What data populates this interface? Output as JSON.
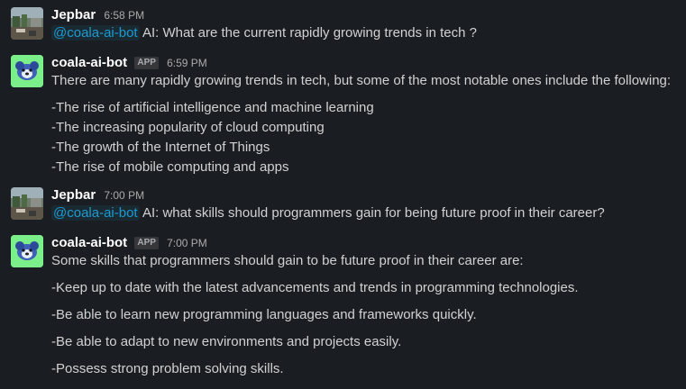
{
  "messages": [
    {
      "author": "Jepbar",
      "time": "6:58 PM",
      "avatar_icon": "photo-avatar",
      "mention": "@coala-ai-bot",
      "text": "AI: What are the current rapidly growing trends in tech ?"
    },
    {
      "author": "coala-ai-bot",
      "badge": "APP",
      "time": "6:59 PM",
      "avatar_icon": "bot-avatar",
      "intro": "There are many rapidly growing trends in tech, but some of the most notable ones include the following:",
      "items": [
        "-The rise of artificial intelligence and machine learning",
        "-The increasing popularity of cloud computing",
        "-The growth of the Internet of Things",
        "-The rise of mobile computing and apps"
      ]
    },
    {
      "author": "Jepbar",
      "time": "7:00 PM",
      "avatar_icon": "photo-avatar",
      "mention": "@coala-ai-bot",
      "text": "AI: what skills should programmers gain for being future proof in their career?"
    },
    {
      "author": "coala-ai-bot",
      "badge": "APP",
      "time": "7:00 PM",
      "avatar_icon": "bot-avatar",
      "intro": "Some skills that programmers should gain to be future proof in their career are:",
      "items": [
        "-Keep up to date with the latest advancements and trends in programming technologies.",
        "-Be able to learn new programming languages and frameworks quickly.",
        "-Be able to adapt to new environments and projects easily.",
        "-Possess strong problem solving skills."
      ]
    }
  ],
  "colors": {
    "background": "#1a1d21",
    "text": "#d1d2d3",
    "mention": "#1d9bd1",
    "bot_avatar_bg": "#7bf08a"
  }
}
